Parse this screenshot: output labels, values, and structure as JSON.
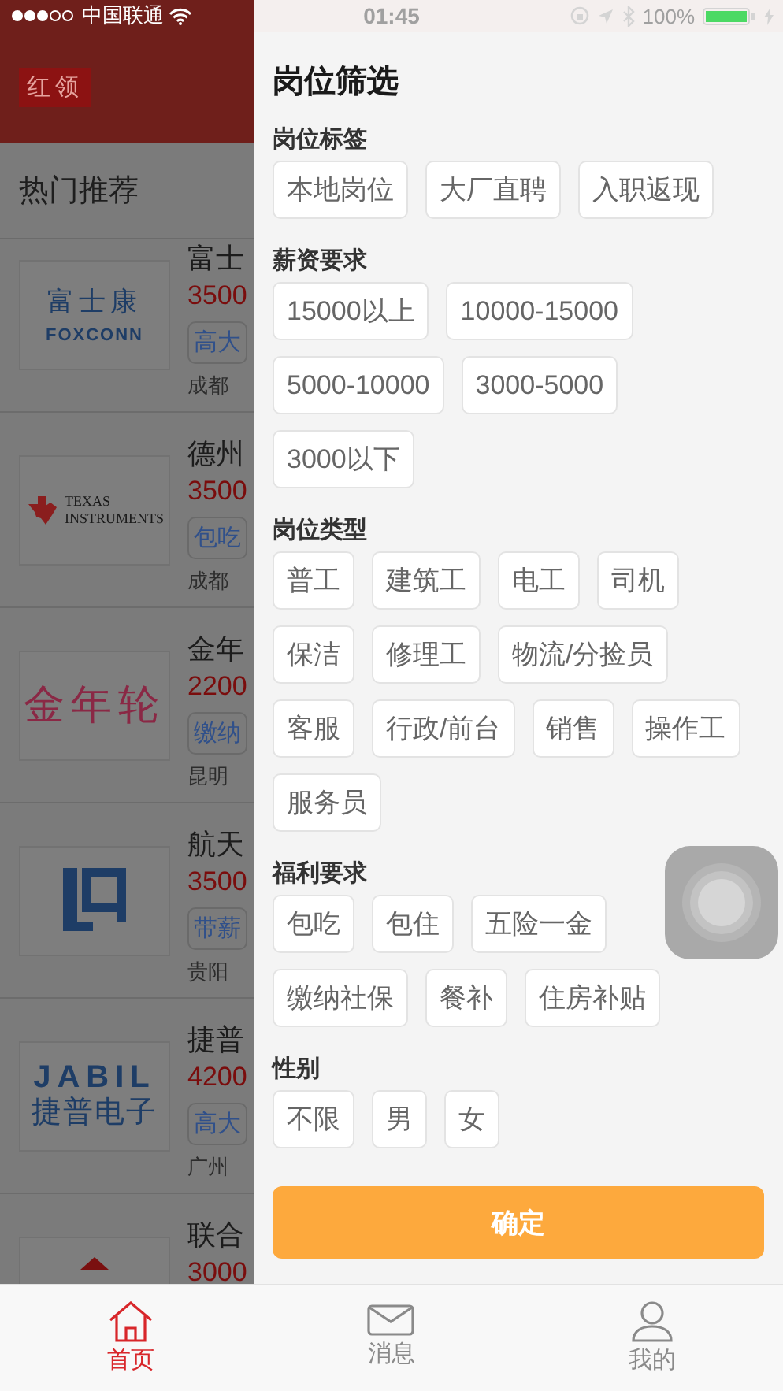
{
  "status_bar": {
    "carrier": "中国联通",
    "time": "01:45",
    "battery": "100%"
  },
  "header": {
    "logo": "红领"
  },
  "section_title": "热门推荐",
  "jobs": [
    {
      "kind": "foxconn",
      "logo_lines": [
        "富士康",
        "FOXCONN"
      ],
      "title": "富士",
      "salary": "3500",
      "tag": "高大",
      "location": "成都"
    },
    {
      "kind": "ti",
      "logo_lines": [
        "TEXAS",
        "INSTRUMENTS"
      ],
      "title": "德州",
      "salary": "3500",
      "tag": "包吃",
      "location": "成都"
    },
    {
      "kind": "jinnianlun",
      "logo_lines": [
        "金年轮"
      ],
      "title": "金年",
      "salary": "2200",
      "tag": "缴纳",
      "location": "昆明"
    },
    {
      "kind": "linquan",
      "title": "航天",
      "salary": "3500",
      "tag": "带薪",
      "location": "贵阳"
    },
    {
      "kind": "jabil",
      "logo_lines": [
        "JABIL",
        "捷普电子"
      ],
      "title": "捷普",
      "salary": "4200",
      "tag": "高大",
      "location": "广州"
    },
    {
      "kind": "partial",
      "title": "联合",
      "salary": "3000"
    }
  ],
  "filter": {
    "title": "岗位筛选",
    "groups": [
      {
        "label": "岗位标签",
        "options": [
          {
            "label": "本地岗位",
            "selected": false
          },
          {
            "label": "大厂直聘",
            "selected": false
          },
          {
            "label": "入职返现",
            "selected": false
          }
        ]
      },
      {
        "label": "薪资要求",
        "options": [
          {
            "label": "15000以上",
            "selected": false
          },
          {
            "label": "10000-15000",
            "selected": false
          },
          {
            "label": "5000-10000",
            "selected": false
          },
          {
            "label": "3000-5000",
            "selected": false
          },
          {
            "label": "3000以下",
            "selected": false
          }
        ]
      },
      {
        "label": "岗位类型",
        "options": [
          {
            "label": "普工",
            "selected": false
          },
          {
            "label": "建筑工",
            "selected": false
          },
          {
            "label": "电工",
            "selected": false
          },
          {
            "label": "司机",
            "selected": false
          },
          {
            "label": "保洁",
            "selected": false
          },
          {
            "label": "修理工",
            "selected": false
          },
          {
            "label": "物流/分捡员",
            "selected": false
          },
          {
            "label": "客服",
            "selected": false
          },
          {
            "label": "行政/前台",
            "selected": false
          },
          {
            "label": "销售",
            "selected": false
          },
          {
            "label": "操作工",
            "selected": false
          },
          {
            "label": "服务员",
            "selected": false
          }
        ]
      },
      {
        "label": "福利要求",
        "options": [
          {
            "label": "包吃",
            "selected": false
          },
          {
            "label": "包住",
            "selected": false
          },
          {
            "label": "五险一金",
            "selected": false
          },
          {
            "label": "缴纳社保",
            "selected": false
          },
          {
            "label": "餐补",
            "selected": false
          },
          {
            "label": "住房补贴",
            "selected": false
          }
        ]
      },
      {
        "label": "性别",
        "options": [
          {
            "label": "不限",
            "selected": false
          },
          {
            "label": "男",
            "selected": false
          },
          {
            "label": "女",
            "selected": false
          }
        ]
      }
    ],
    "confirm": "确定"
  },
  "tab_bar": [
    {
      "kind": "home",
      "label": "首页",
      "selected": true
    },
    {
      "kind": "message",
      "label": "消息",
      "selected": false
    },
    {
      "kind": "profile",
      "label": "我的",
      "selected": false
    }
  ]
}
